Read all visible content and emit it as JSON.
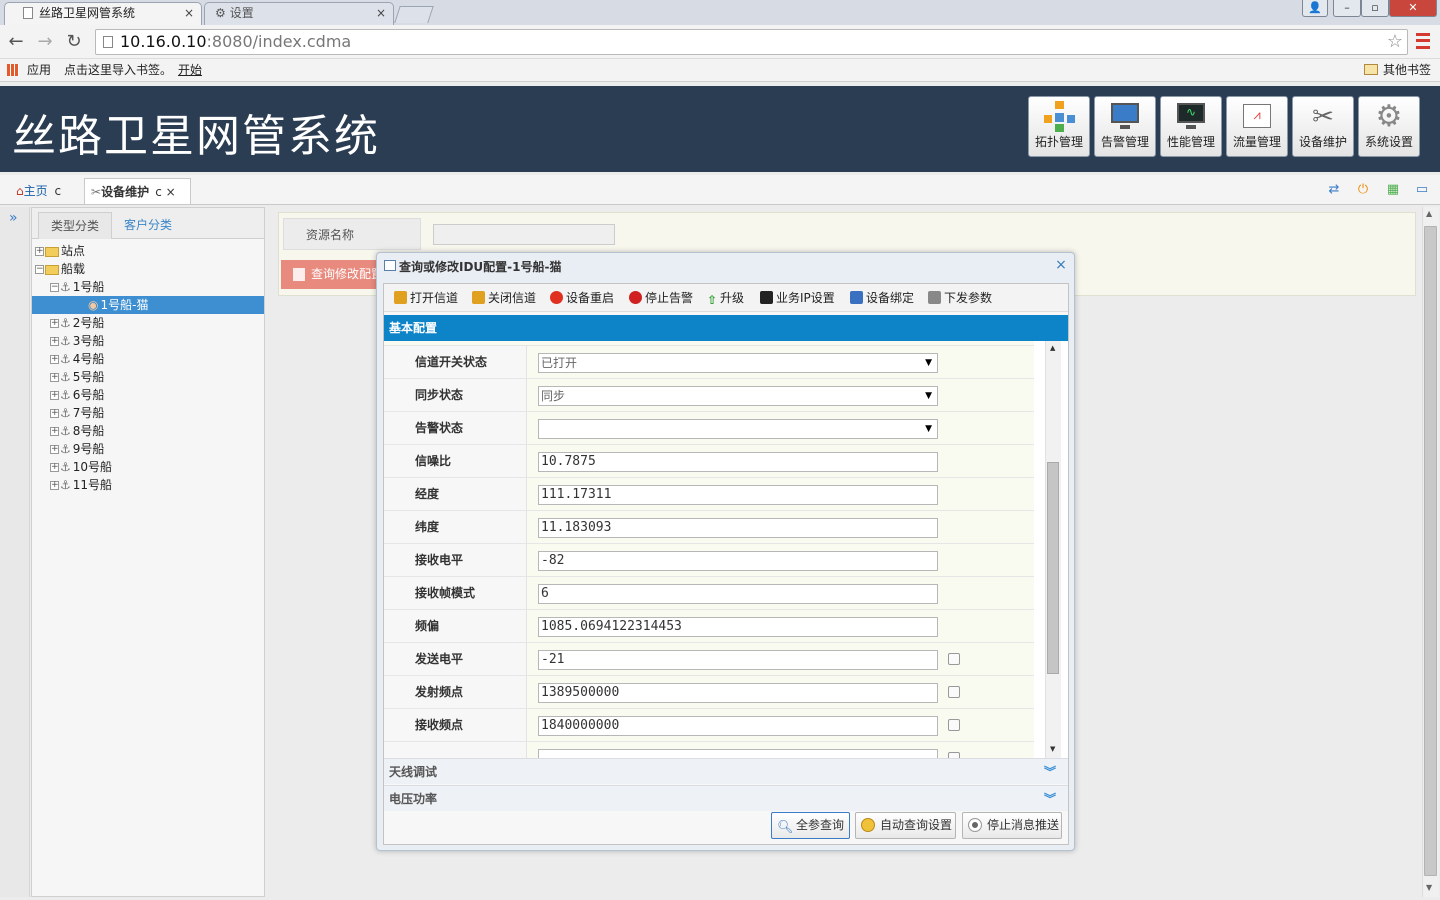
{
  "browser": {
    "tabs": [
      {
        "title": "丝路卫星网管系统",
        "active": true
      },
      {
        "title": "设置",
        "active": false
      }
    ],
    "url_host": "10.16.0.10",
    "url_rest": ":8080/index.cdma",
    "bookmarks": {
      "apps": "应用",
      "import_hint": "点击这里导入书签。",
      "start": "开始",
      "other": "其他书签"
    }
  },
  "app": {
    "title": "丝路卫星网管系统",
    "modules": [
      "拓扑管理",
      "告警管理",
      "性能管理",
      "流量管理",
      "设备维护",
      "系统设置"
    ],
    "tabs": [
      {
        "label": "主页",
        "suffix": "c"
      },
      {
        "label": "设备维护",
        "suffix": "c ×"
      }
    ]
  },
  "left_panel": {
    "tabs": [
      "类型分类",
      "客户分类"
    ],
    "tree": [
      {
        "label": "站点",
        "level": 0,
        "toggle": "+",
        "icon": "folder"
      },
      {
        "label": "船载",
        "level": 0,
        "toggle": "−",
        "icon": "folder"
      },
      {
        "label": "1号船",
        "level": 1,
        "toggle": "−",
        "icon": "anchor"
      },
      {
        "label": "1号船-猫",
        "level": 2,
        "toggle": "",
        "icon": "modem",
        "selected": true
      },
      {
        "label": "2号船",
        "level": 1,
        "toggle": "+",
        "icon": "anchor"
      },
      {
        "label": "3号船",
        "level": 1,
        "toggle": "+",
        "icon": "anchor"
      },
      {
        "label": "4号船",
        "level": 1,
        "toggle": "+",
        "icon": "anchor"
      },
      {
        "label": "5号船",
        "level": 1,
        "toggle": "+",
        "icon": "anchor"
      },
      {
        "label": "6号船",
        "level": 1,
        "toggle": "+",
        "icon": "anchor"
      },
      {
        "label": "7号船",
        "level": 1,
        "toggle": "+",
        "icon": "anchor"
      },
      {
        "label": "8号船",
        "level": 1,
        "toggle": "+",
        "icon": "anchor"
      },
      {
        "label": "9号船",
        "level": 1,
        "toggle": "+",
        "icon": "anchor"
      },
      {
        "label": "10号船",
        "level": 1,
        "toggle": "+",
        "icon": "anchor"
      },
      {
        "label": "11号船",
        "level": 1,
        "toggle": "+",
        "icon": "anchor"
      }
    ]
  },
  "main": {
    "resource_label": "资源名称",
    "resource_value": "",
    "query_button": "查询修改配置"
  },
  "dialog": {
    "title": "查询或修改IDU配置-1号船-猫",
    "close": "×",
    "toolbar": [
      {
        "label": "打开信道",
        "icon": "lock-open-icon",
        "color": "#e0a020"
      },
      {
        "label": "关闭信道",
        "icon": "lock-icon",
        "color": "#e0a020"
      },
      {
        "label": "设备重启",
        "icon": "red-dot-icon",
        "color": "#e03020"
      },
      {
        "label": "停止告警",
        "icon": "alert-icon",
        "color": "#d02020"
      },
      {
        "label": "升级",
        "icon": "arrow-up-icon",
        "color": "#2a9a2a"
      },
      {
        "label": "业务IP设置",
        "icon": "terminal-icon",
        "color": "#222222"
      },
      {
        "label": "设备绑定",
        "icon": "pen-icon",
        "color": "#3a70c0"
      },
      {
        "label": "下发参数",
        "icon": "gear-icon",
        "color": "#888888"
      }
    ],
    "section_basic": "基本配置",
    "fields": [
      {
        "label": "信道开关状态",
        "value": "已打开",
        "type": "select",
        "checkbox": false
      },
      {
        "label": "同步状态",
        "value": "同步",
        "type": "select",
        "checkbox": false
      },
      {
        "label": "告警状态",
        "value": "",
        "type": "select",
        "checkbox": false
      },
      {
        "label": "信噪比",
        "value": "10.7875",
        "type": "text",
        "checkbox": false
      },
      {
        "label": "经度",
        "value": "111.17311",
        "type": "text",
        "checkbox": false
      },
      {
        "label": "纬度",
        "value": "11.183093",
        "type": "text",
        "checkbox": false
      },
      {
        "label": "接收电平",
        "value": "-82",
        "type": "text",
        "checkbox": false
      },
      {
        "label": "接收帧模式",
        "value": "6",
        "type": "text",
        "checkbox": false
      },
      {
        "label": "频偏",
        "value": "1085.0694122314453",
        "type": "text",
        "checkbox": false
      },
      {
        "label": "发送电平",
        "value": "-21",
        "type": "text",
        "checkbox": true
      },
      {
        "label": "发射频点",
        "value": "1389500000",
        "type": "text",
        "checkbox": true
      },
      {
        "label": "接收频点",
        "value": "1840000000",
        "type": "text",
        "checkbox": true
      }
    ],
    "section_antenna": "天线调试",
    "section_power": "电压功率",
    "buttons": [
      "全参查询",
      "自动查询设置",
      "停止消息推送"
    ]
  }
}
